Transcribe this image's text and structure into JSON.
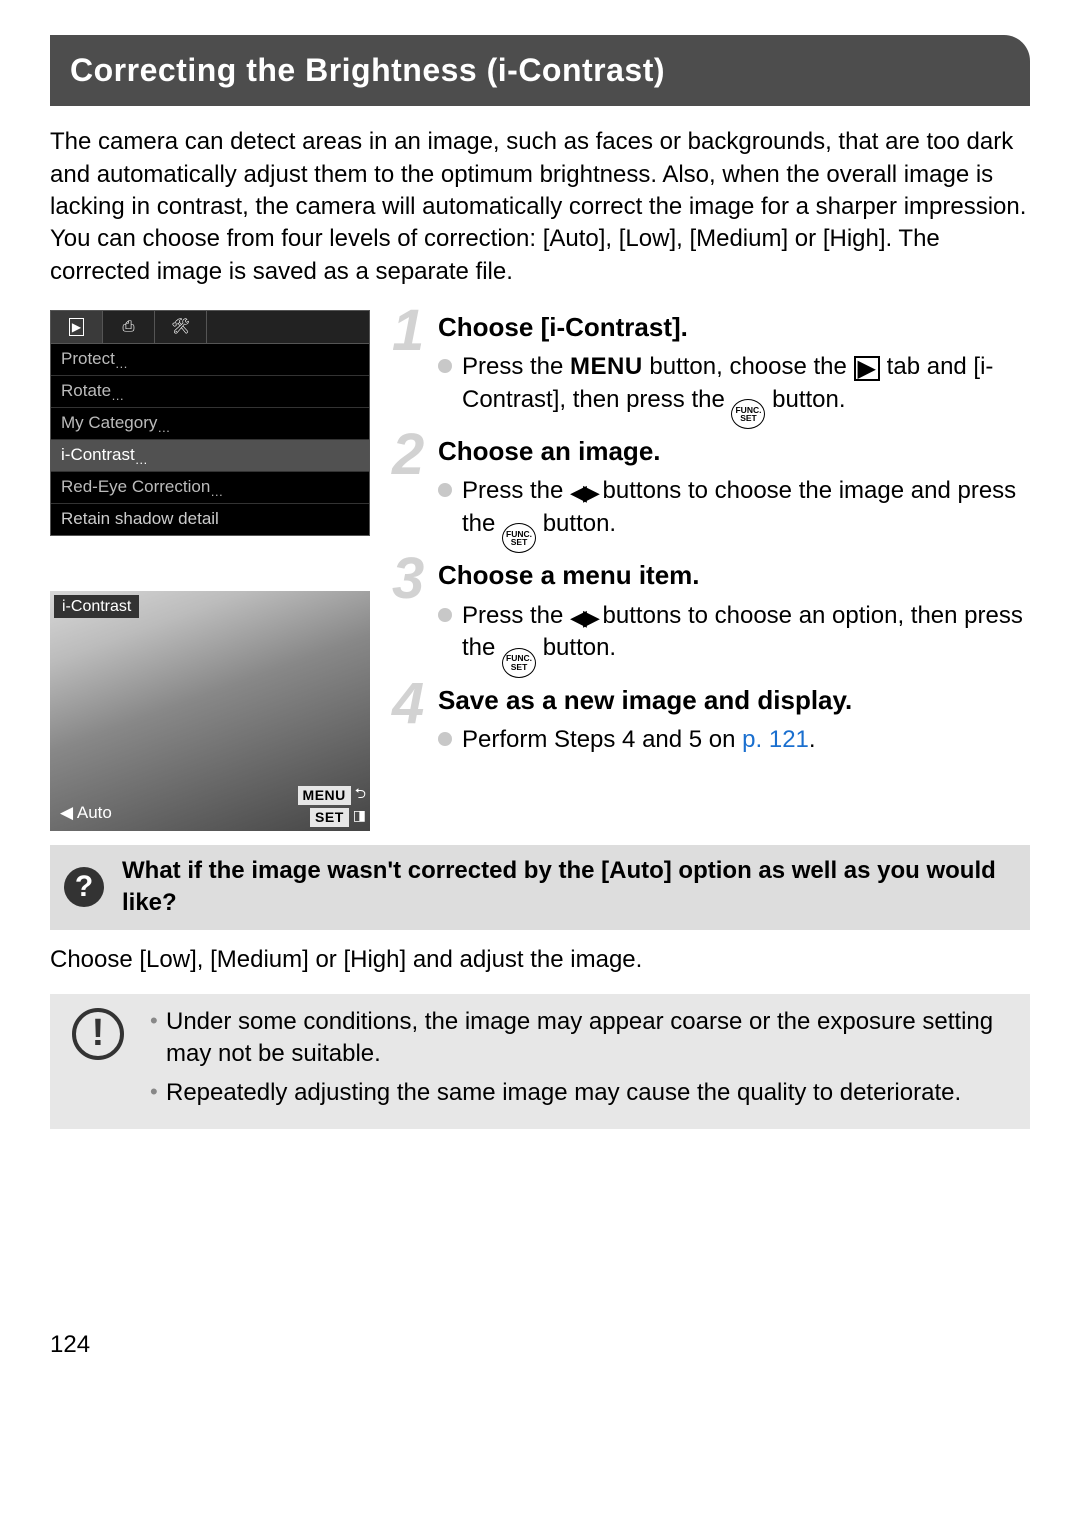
{
  "title": "Correcting the Brightness (i-Contrast)",
  "intro": "The camera can detect areas in an image, such as faces or backgrounds, that are too dark and automatically adjust them to the optimum brightness. Also, when the overall image is lacking in contrast, the camera will automatically correct the image for a sharper impression.\nYou can choose from four levels of correction: [Auto], [Low], [Medium] or [High]. The corrected image is saved as a separate file.",
  "menu_screen": {
    "items": [
      "Protect",
      "Rotate",
      "My Category",
      "i-Contrast",
      "Red-Eye Correction"
    ],
    "footer": "Retain shadow detail",
    "selected_index": 3
  },
  "live_screen": {
    "label": "i-Contrast",
    "bottom_left_prefix": "◀",
    "bottom_left": "Auto",
    "tag_menu": "MENU",
    "tag_set": "SET"
  },
  "steps": [
    {
      "num": "1",
      "head": "Choose [i-Contrast].",
      "body_pre": "Press the ",
      "menu_label": "MENU",
      "body_mid1": " button, choose the ",
      "play_icon": "▶",
      "body_mid2": " tab and [i-Contrast], then press the ",
      "func_top": "FUNC.",
      "func_bot": "SET",
      "body_post": " button."
    },
    {
      "num": "2",
      "head": "Choose an image.",
      "body_pre": "Press the ",
      "arrows": "◀▶",
      "body_mid": " buttons to choose the image and press the ",
      "func_top": "FUNC.",
      "func_bot": "SET",
      "body_post": " button."
    },
    {
      "num": "3",
      "head": "Choose a menu item.",
      "body_pre": "Press the ",
      "arrows": "◀▶",
      "body_mid": " buttons to choose an option, then press the ",
      "func_top": "FUNC.",
      "func_bot": "SET",
      "body_post": " button."
    },
    {
      "num": "4",
      "head": "Save as a new image and display.",
      "body_pre": "Perform Steps 4 and 5 on ",
      "link": "p. 121",
      "body_post": "."
    }
  ],
  "question": {
    "text": "What if the image wasn't corrected by the [Auto] option as well as you would like?",
    "answer": "Choose [Low], [Medium] or [High] and adjust the image."
  },
  "caution": [
    "Under some conditions, the image may appear coarse or the exposure setting may not be suitable.",
    "Repeatedly adjusting the same image may cause the quality to deteriorate."
  ],
  "page_number": "124"
}
